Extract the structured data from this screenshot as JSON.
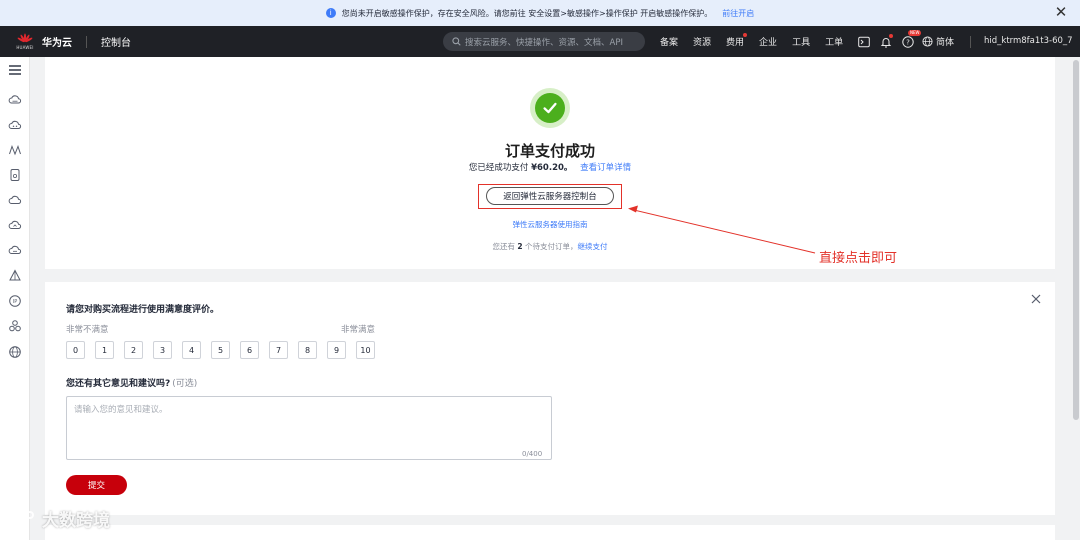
{
  "notice": {
    "text": "您尚未开启敏感操作保护，存在安全风险。请您前往 安全设置>敏感操作>操作保护 开启敏感操作保护。",
    "link": "前往开启"
  },
  "topnav": {
    "logo_text": "HUAWEI",
    "brand": "华为云",
    "console": "控制台",
    "search_placeholder": "搜索云服务、快捷操作、资源、文档、API",
    "links": [
      "备案",
      "资源",
      "费用",
      "企业",
      "工具",
      "工单"
    ],
    "help_badge": "NEW",
    "lang": "简体",
    "user": "hid_ktrm8fa1t3-60_7"
  },
  "result": {
    "title": "订单支付成功",
    "paid_prefix": "您已经成功支付",
    "amount": "¥60.20。",
    "view_order": "查看订单详情",
    "return_button": "返回弹性云服务器控制台",
    "guide_link": "弹性云服务器使用指南",
    "pending_prefix": "您还有",
    "pending_count": "2",
    "pending_suffix": "个待支付订单，",
    "pending_link": "继续支付"
  },
  "annotation": {
    "text": "直接点击即可"
  },
  "survey": {
    "question1": "请您对购买流程进行使用满意度评价。",
    "scale_low": "非常不满意",
    "scale_high": "非常满意",
    "ratings": [
      "0",
      "1",
      "2",
      "3",
      "4",
      "5",
      "6",
      "7",
      "8",
      "9",
      "10"
    ],
    "question2": "您还有其它意见和建议吗?",
    "optional": "(可选)",
    "textarea_placeholder": "请输入您的意见和建议。",
    "counter": "0/400",
    "submit": "提交"
  },
  "watermark": "大数跨境",
  "colors": {
    "accent": "#c7000b",
    "link": "#3e7bf8",
    "success": "#4caf1d",
    "annotation": "#e3322a",
    "nav_bg": "#1f2126"
  }
}
